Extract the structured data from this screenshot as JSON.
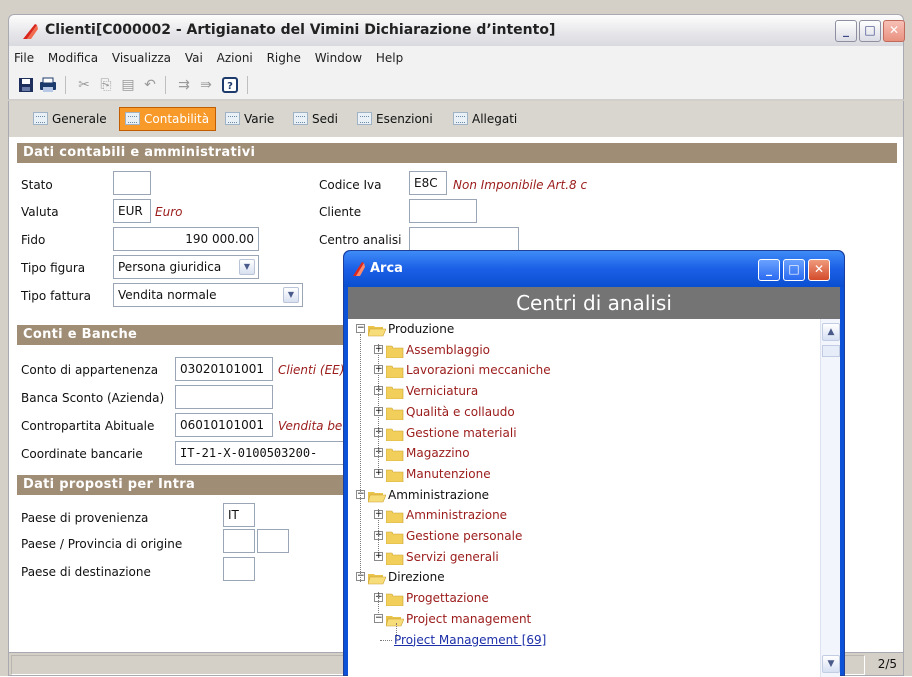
{
  "window": {
    "title": "Clienti[C000002 - Artigianato del  Vimini Dichiarazione d’intento]",
    "controls": {
      "minimize": "_",
      "maximize": "□",
      "close": "✕"
    }
  },
  "menu": [
    "File",
    "Modifica",
    "Visualizza",
    "Vai",
    "Azioni",
    "Righe",
    "Window",
    "Help"
  ],
  "toolbar_icons": [
    "save-icon",
    "print-icon",
    "cut-icon",
    "copy-icon",
    "paste-icon",
    "undo-icon",
    "insert-row-icon",
    "move-row-icon",
    "help-icon"
  ],
  "tabs": [
    {
      "label": "Generale",
      "active": false
    },
    {
      "label": "Contabilità",
      "active": true
    },
    {
      "label": "Varie",
      "active": false
    },
    {
      "label": "Sedi",
      "active": false
    },
    {
      "label": "Esenzioni",
      "active": false
    },
    {
      "label": "Allegati",
      "active": false
    }
  ],
  "sections": {
    "contabili": "Dati contabili e amministrativi",
    "banche": "Conti e Banche",
    "intra": "Dati proposti per Intra"
  },
  "fields": {
    "stato": {
      "label": "Stato",
      "value": ""
    },
    "valuta": {
      "label": "Valuta",
      "value": "EUR",
      "desc": "Euro"
    },
    "fido": {
      "label": "Fido",
      "value": "190 000.00"
    },
    "tipo_figura": {
      "label": "Tipo figura",
      "value": "Persona giuridica"
    },
    "tipo_fattura": {
      "label": "Tipo fattura",
      "value": "Vendita normale"
    },
    "codice_iva": {
      "label": "Codice Iva",
      "value": "E8C",
      "desc": "Non Imponibile  Art.8 c"
    },
    "cliente": {
      "label": "Cliente",
      "value": ""
    },
    "centro_analisi": {
      "label": "Centro analisi",
      "value": ""
    },
    "conto_appartenenza": {
      "label": "Conto di appartenenza",
      "value": "03020101001",
      "desc": "Clienti (EE)"
    },
    "banca_sconto": {
      "label": "Banca Sconto (Azienda)",
      "value": ""
    },
    "contropartita": {
      "label": "Contropartita Abituale",
      "value": "06010101001",
      "desc": "Vendita be"
    },
    "coordinate": {
      "label": "Coordinate bancarie",
      "value": "IT-21-X-0100503200-"
    },
    "paese_provenienza": {
      "label": "Paese di provenienza",
      "value": "IT"
    },
    "paese_origine": {
      "label": "Paese / Provincia di origine",
      "value": ""
    },
    "paese_destinazione": {
      "label": "Paese di destinazione",
      "value": ""
    }
  },
  "status": {
    "page": "2/5"
  },
  "dialog": {
    "title": "Arca",
    "header": "Centri di analisi",
    "tree": [
      {
        "label": "Produzione",
        "level": 0,
        "expanded": true
      },
      {
        "label": "Assemblaggio",
        "level": 1,
        "expanded": false
      },
      {
        "label": "Lavorazioni meccaniche",
        "level": 1,
        "expanded": false
      },
      {
        "label": "Verniciatura",
        "level": 1,
        "expanded": false
      },
      {
        "label": "Qualità e collaudo",
        "level": 1,
        "expanded": false
      },
      {
        "label": "Gestione materiali",
        "level": 1,
        "expanded": false
      },
      {
        "label": "Magazzino",
        "level": 1,
        "expanded": false
      },
      {
        "label": "Manutenzione",
        "level": 1,
        "expanded": false
      },
      {
        "label": "Amministrazione",
        "level": 0,
        "expanded": true
      },
      {
        "label": "Amministrazione",
        "level": 1,
        "expanded": false
      },
      {
        "label": "Gestione personale",
        "level": 1,
        "expanded": false
      },
      {
        "label": "Servizi generali",
        "level": 1,
        "expanded": false
      },
      {
        "label": "Direzione",
        "level": 0,
        "expanded": true
      },
      {
        "label": "Progettazione",
        "level": 1,
        "expanded": false
      },
      {
        "label": "Project management",
        "level": 1,
        "expanded": true
      },
      {
        "label": "Project Management  [69]",
        "level": 2,
        "expanded": false
      }
    ]
  },
  "colors": {
    "accent_tab": "#f89a2a",
    "section_header": "#a08d76",
    "dialog_blue": "#0b52d8",
    "desc_red": "#9b1b1b"
  }
}
